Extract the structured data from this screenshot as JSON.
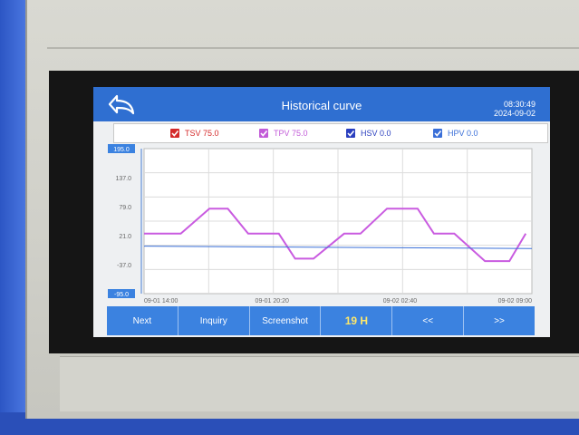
{
  "header": {
    "title": "Historical curve",
    "time": "08:30:49",
    "date": "2024-09-02"
  },
  "legend": [
    {
      "label": "TSV",
      "value": "75.0",
      "color": "#d42a2a",
      "checked": true
    },
    {
      "label": "TPV",
      "value": "75.0",
      "color": "#c25bd8",
      "checked": true
    },
    {
      "label": "HSV",
      "value": "0.0",
      "color": "#2a3fbf",
      "checked": true
    },
    {
      "label": "HPV",
      "value": "0.0",
      "color": "#3a6fd8",
      "checked": true
    }
  ],
  "chart_data": {
    "type": "line",
    "ylim": [
      -95.0,
      195.0
    ],
    "y_ticks": [
      "195.0",
      "137.0",
      "79.0",
      "21.0",
      "-37.0",
      "-95.0"
    ],
    "x_ticks": [
      "09-01 14:00",
      "09-01 20:20",
      "09-02 02:40",
      "09-02 09:00"
    ],
    "series": [
      {
        "name": "TPV",
        "color": "#c95be0",
        "x": [
          0,
          0.6,
          0.9,
          1.3,
          1.8,
          3.2,
          4.1,
          5.1,
          6.6,
          7.4,
          8.3,
          9.8,
          10.6,
          11.9,
          13.4,
          14.2,
          15.2,
          16.7,
          17.9,
          18.7
        ],
        "y": [
          25,
          25,
          25,
          25,
          25,
          75,
          75,
          25,
          25,
          -25,
          -25,
          25,
          25,
          75,
          75,
          25,
          25,
          -30,
          -30,
          25
        ]
      },
      {
        "name": "HPV",
        "color": "#3a6fd8",
        "x": [
          0,
          19
        ],
        "y": [
          0,
          -5
        ]
      }
    ]
  },
  "nav": {
    "next": "Next",
    "inquiry": "Inquiry",
    "screenshot": "Screenshot",
    "hours": "19 H",
    "prev_page": "<<",
    "next_page": ">>"
  }
}
